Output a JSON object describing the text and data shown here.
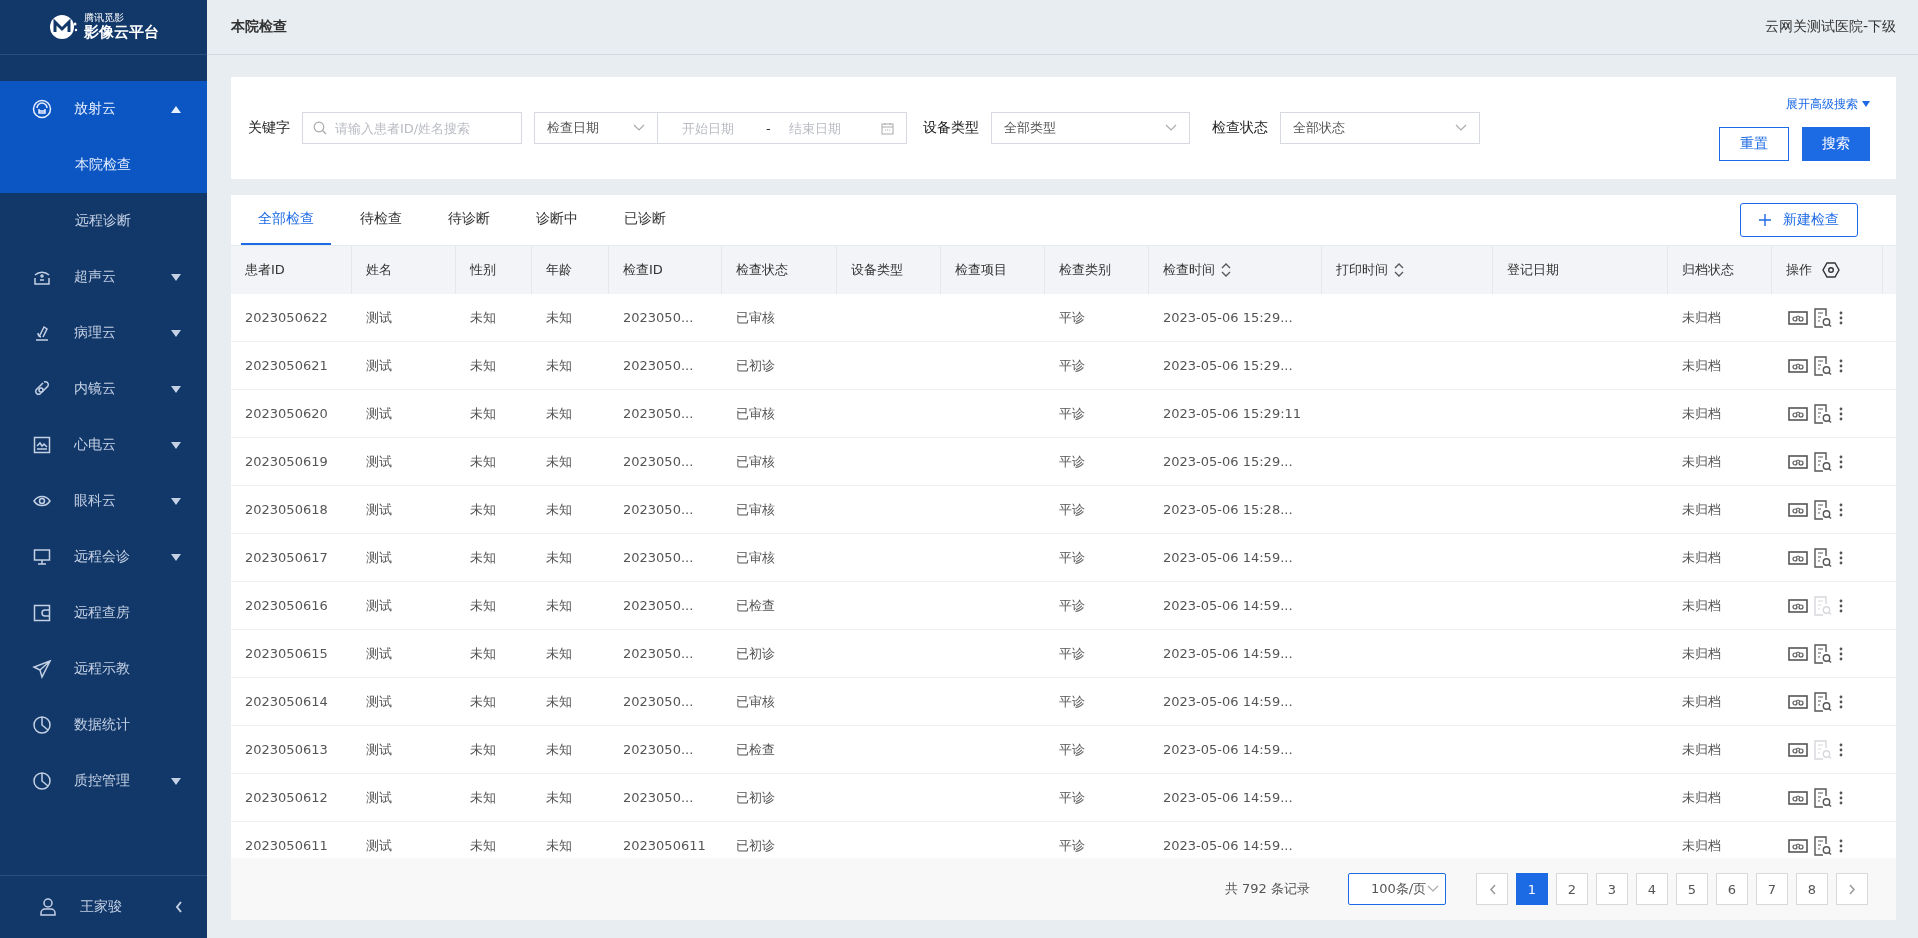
{
  "sidebar": {
    "logo": {
      "subtitle": "腾讯觅影",
      "title": "影像云平台"
    },
    "items": [
      {
        "kind": "group",
        "label": "放射云",
        "expanded": true,
        "selected": true,
        "children": [
          {
            "label": "本院检查",
            "selected": true
          },
          {
            "label": "远程诊断",
            "selected": false
          }
        ]
      },
      {
        "kind": "group",
        "label": "超声云",
        "expanded": false,
        "selected": false
      },
      {
        "kind": "group",
        "label": "病理云",
        "expanded": false,
        "selected": false
      },
      {
        "kind": "group",
        "label": "内镜云",
        "expanded": false,
        "selected": false
      },
      {
        "kind": "group",
        "label": "心电云",
        "expanded": false,
        "selected": false
      },
      {
        "kind": "group",
        "label": "眼科云",
        "expanded": false,
        "selected": false
      },
      {
        "kind": "group",
        "label": "远程会诊",
        "expanded": false,
        "selected": false
      },
      {
        "kind": "link",
        "label": "远程查房",
        "selected": false
      },
      {
        "kind": "link",
        "label": "远程示教",
        "selected": false
      },
      {
        "kind": "link",
        "label": "数据统计",
        "selected": false
      },
      {
        "kind": "group",
        "label": "质控管理",
        "expanded": false,
        "selected": false
      }
    ],
    "user": "王家骏"
  },
  "header": {
    "title": "本院检查",
    "hospital": "云网关测试医院-下级"
  },
  "filters": {
    "keyword": {
      "label": "关键字",
      "placeholder": "请输入患者ID/姓名搜索"
    },
    "date": {
      "type": "检查日期",
      "start_placeholder": "开始日期",
      "separator": "-",
      "end_placeholder": "结束日期"
    },
    "device": {
      "label": "设备类型",
      "value": "全部类型"
    },
    "status": {
      "label": "检查状态",
      "value": "全部状态"
    },
    "advanced_link": "展开高级搜索",
    "reset_button": "重置",
    "search_button": "搜索"
  },
  "tabs": [
    {
      "label": "全部检查",
      "selected": true
    },
    {
      "label": "待检查",
      "selected": false
    },
    {
      "label": "待诊断",
      "selected": false
    },
    {
      "label": "诊断中",
      "selected": false
    },
    {
      "label": "已诊断",
      "selected": false
    }
  ],
  "new_button": "新建检查",
  "table": {
    "columns": [
      {
        "label": "患者ID",
        "kind": "plain"
      },
      {
        "label": "姓名",
        "kind": "plain"
      },
      {
        "label": "性别",
        "kind": "plain"
      },
      {
        "label": "年龄",
        "kind": "plain"
      },
      {
        "label": "检查ID",
        "kind": "plain"
      },
      {
        "label": "检查状态",
        "kind": "plain"
      },
      {
        "label": "设备类型",
        "kind": "plain"
      },
      {
        "label": "检查项目",
        "kind": "plain"
      },
      {
        "label": "检查类别",
        "kind": "plain"
      },
      {
        "label": "检查时间",
        "kind": "sortable"
      },
      {
        "label": "打印时间",
        "kind": "sortable"
      },
      {
        "label": "登记日期",
        "kind": "plain"
      },
      {
        "label": "归档状态",
        "kind": "plain"
      },
      {
        "label": "操作",
        "kind": "actions"
      }
    ],
    "rows": [
      {
        "patient_id": "2023050622",
        "name": "测试",
        "sex": "未知",
        "age": "未知",
        "exam_id": "2023050...",
        "status": "已审核",
        "category": "平诊",
        "exam_time": "2023-05-06 15:29...",
        "archive": "未归档",
        "report_enabled": true
      },
      {
        "patient_id": "2023050621",
        "name": "测试",
        "sex": "未知",
        "age": "未知",
        "exam_id": "2023050...",
        "status": "已初诊",
        "category": "平诊",
        "exam_time": "2023-05-06 15:29...",
        "archive": "未归档",
        "report_enabled": true
      },
      {
        "patient_id": "2023050620",
        "name": "测试",
        "sex": "未知",
        "age": "未知",
        "exam_id": "2023050...",
        "status": "已审核",
        "category": "平诊",
        "exam_time": "2023-05-06 15:29:11",
        "archive": "未归档",
        "report_enabled": true
      },
      {
        "patient_id": "2023050619",
        "name": "测试",
        "sex": "未知",
        "age": "未知",
        "exam_id": "2023050...",
        "status": "已审核",
        "category": "平诊",
        "exam_time": "2023-05-06 15:29...",
        "archive": "未归档",
        "report_enabled": true
      },
      {
        "patient_id": "2023050618",
        "name": "测试",
        "sex": "未知",
        "age": "未知",
        "exam_id": "2023050...",
        "status": "已审核",
        "category": "平诊",
        "exam_time": "2023-05-06 15:28...",
        "archive": "未归档",
        "report_enabled": true
      },
      {
        "patient_id": "2023050617",
        "name": "测试",
        "sex": "未知",
        "age": "未知",
        "exam_id": "2023050...",
        "status": "已审核",
        "category": "平诊",
        "exam_time": "2023-05-06 14:59...",
        "archive": "未归档",
        "report_enabled": true
      },
      {
        "patient_id": "2023050616",
        "name": "测试",
        "sex": "未知",
        "age": "未知",
        "exam_id": "2023050...",
        "status": "已检查",
        "category": "平诊",
        "exam_time": "2023-05-06 14:59...",
        "archive": "未归档",
        "report_enabled": false
      },
      {
        "patient_id": "2023050615",
        "name": "测试",
        "sex": "未知",
        "age": "未知",
        "exam_id": "2023050...",
        "status": "已初诊",
        "category": "平诊",
        "exam_time": "2023-05-06 14:59...",
        "archive": "未归档",
        "report_enabled": true
      },
      {
        "patient_id": "2023050614",
        "name": "测试",
        "sex": "未知",
        "age": "未知",
        "exam_id": "2023050...",
        "status": "已审核",
        "category": "平诊",
        "exam_time": "2023-05-06 14:59...",
        "archive": "未归档",
        "report_enabled": true
      },
      {
        "patient_id": "2023050613",
        "name": "测试",
        "sex": "未知",
        "age": "未知",
        "exam_id": "2023050...",
        "status": "已检查",
        "category": "平诊",
        "exam_time": "2023-05-06 14:59...",
        "archive": "未归档",
        "report_enabled": false
      },
      {
        "patient_id": "2023050612",
        "name": "测试",
        "sex": "未知",
        "age": "未知",
        "exam_id": "2023050...",
        "status": "已初诊",
        "category": "平诊",
        "exam_time": "2023-05-06 14:59...",
        "archive": "未归档",
        "report_enabled": true
      },
      {
        "patient_id": "2023050611",
        "name": "测试",
        "sex": "未知",
        "age": "未知",
        "exam_id": "2023050611",
        "status": "已初诊",
        "category": "平诊",
        "exam_time": "2023-05-06 14:59...",
        "archive": "未归档",
        "report_enabled": true
      }
    ]
  },
  "footer": {
    "total": "共 792 条记录",
    "page_size": "100条/页",
    "pages": [
      {
        "label": "1",
        "selected": true
      },
      {
        "label": "2",
        "selected": false
      },
      {
        "label": "3",
        "selected": false
      },
      {
        "label": "4",
        "selected": false
      },
      {
        "label": "5",
        "selected": false
      },
      {
        "label": "6",
        "selected": false
      },
      {
        "label": "7",
        "selected": false
      },
      {
        "label": "8",
        "selected": false
      }
    ]
  }
}
